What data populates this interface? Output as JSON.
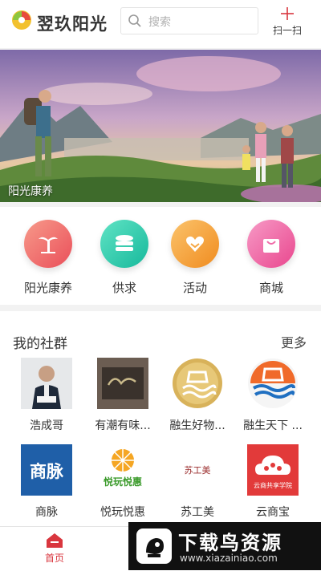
{
  "header": {
    "app_title": "翌玖阳光",
    "search_placeholder": "搜索",
    "scan_label": "扫一扫"
  },
  "banner": {
    "caption": "阳光康养"
  },
  "quick_actions": [
    {
      "label": "阳光康养",
      "icon": "palm-tree-icon",
      "color": "#f0706a"
    },
    {
      "label": "供求",
      "icon": "stack-coins-icon",
      "color": "#2ecfb0"
    },
    {
      "label": "活动",
      "icon": "heart-hand-icon",
      "color": "#f7a23c"
    },
    {
      "label": "商城",
      "icon": "shopping-bag-icon",
      "color": "#f06aa6"
    }
  ],
  "community": {
    "title": "我的社群",
    "more_label": "更多",
    "groups": [
      {
        "name": "浩成哥"
      },
      {
        "name": "有潮有味..."
      },
      {
        "name": "融生好物..."
      },
      {
        "name": "融生天下 ..."
      },
      {
        "name": "商脉",
        "logo_text": "商脉"
      },
      {
        "name": "悦玩悦惠",
        "logo_text": "悦玩悦惠"
      },
      {
        "name": "苏工美",
        "logo_text": "苏工美"
      },
      {
        "name": "云商宝",
        "logo_text": "云商共享学院"
      }
    ]
  },
  "tabbar": {
    "home_label": "首页"
  },
  "watermark": {
    "title": "下载鸟资源",
    "url": "www.xiazainiao.com"
  },
  "colors": {
    "accent": "#d9363e"
  }
}
